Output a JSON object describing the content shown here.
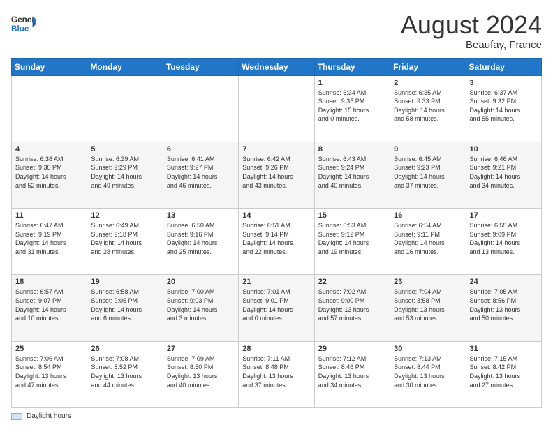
{
  "header": {
    "logo_general": "General",
    "logo_blue": "Blue",
    "month_title": "August 2024",
    "location": "Beaufay, France"
  },
  "legend": {
    "label": "Daylight hours"
  },
  "days_of_week": [
    "Sunday",
    "Monday",
    "Tuesday",
    "Wednesday",
    "Thursday",
    "Friday",
    "Saturday"
  ],
  "weeks": [
    [
      {
        "day": "",
        "info": ""
      },
      {
        "day": "",
        "info": ""
      },
      {
        "day": "",
        "info": ""
      },
      {
        "day": "",
        "info": ""
      },
      {
        "day": "1",
        "info": "Sunrise: 6:34 AM\nSunset: 9:35 PM\nDaylight: 15 hours\nand 0 minutes."
      },
      {
        "day": "2",
        "info": "Sunrise: 6:35 AM\nSunset: 9:33 PM\nDaylight: 14 hours\nand 58 minutes."
      },
      {
        "day": "3",
        "info": "Sunrise: 6:37 AM\nSunset: 9:32 PM\nDaylight: 14 hours\nand 55 minutes."
      }
    ],
    [
      {
        "day": "4",
        "info": "Sunrise: 6:38 AM\nSunset: 9:30 PM\nDaylight: 14 hours\nand 52 minutes."
      },
      {
        "day": "5",
        "info": "Sunrise: 6:39 AM\nSunset: 9:29 PM\nDaylight: 14 hours\nand 49 minutes."
      },
      {
        "day": "6",
        "info": "Sunrise: 6:41 AM\nSunset: 9:27 PM\nDaylight: 14 hours\nand 46 minutes."
      },
      {
        "day": "7",
        "info": "Sunrise: 6:42 AM\nSunset: 9:26 PM\nDaylight: 14 hours\nand 43 minutes."
      },
      {
        "day": "8",
        "info": "Sunrise: 6:43 AM\nSunset: 9:24 PM\nDaylight: 14 hours\nand 40 minutes."
      },
      {
        "day": "9",
        "info": "Sunrise: 6:45 AM\nSunset: 9:23 PM\nDaylight: 14 hours\nand 37 minutes."
      },
      {
        "day": "10",
        "info": "Sunrise: 6:46 AM\nSunset: 9:21 PM\nDaylight: 14 hours\nand 34 minutes."
      }
    ],
    [
      {
        "day": "11",
        "info": "Sunrise: 6:47 AM\nSunset: 9:19 PM\nDaylight: 14 hours\nand 31 minutes."
      },
      {
        "day": "12",
        "info": "Sunrise: 6:49 AM\nSunset: 9:18 PM\nDaylight: 14 hours\nand 28 minutes."
      },
      {
        "day": "13",
        "info": "Sunrise: 6:50 AM\nSunset: 9:16 PM\nDaylight: 14 hours\nand 25 minutes."
      },
      {
        "day": "14",
        "info": "Sunrise: 6:51 AM\nSunset: 9:14 PM\nDaylight: 14 hours\nand 22 minutes."
      },
      {
        "day": "15",
        "info": "Sunrise: 6:53 AM\nSunset: 9:12 PM\nDaylight: 14 hours\nand 19 minutes."
      },
      {
        "day": "16",
        "info": "Sunrise: 6:54 AM\nSunset: 9:11 PM\nDaylight: 14 hours\nand 16 minutes."
      },
      {
        "day": "17",
        "info": "Sunrise: 6:55 AM\nSunset: 9:09 PM\nDaylight: 14 hours\nand 13 minutes."
      }
    ],
    [
      {
        "day": "18",
        "info": "Sunrise: 6:57 AM\nSunset: 9:07 PM\nDaylight: 14 hours\nand 10 minutes."
      },
      {
        "day": "19",
        "info": "Sunrise: 6:58 AM\nSunset: 9:05 PM\nDaylight: 14 hours\nand 6 minutes."
      },
      {
        "day": "20",
        "info": "Sunrise: 7:00 AM\nSunset: 9:03 PM\nDaylight: 14 hours\nand 3 minutes."
      },
      {
        "day": "21",
        "info": "Sunrise: 7:01 AM\nSunset: 9:01 PM\nDaylight: 14 hours\nand 0 minutes."
      },
      {
        "day": "22",
        "info": "Sunrise: 7:02 AM\nSunset: 9:00 PM\nDaylight: 13 hours\nand 57 minutes."
      },
      {
        "day": "23",
        "info": "Sunrise: 7:04 AM\nSunset: 8:58 PM\nDaylight: 13 hours\nand 53 minutes."
      },
      {
        "day": "24",
        "info": "Sunrise: 7:05 AM\nSunset: 8:56 PM\nDaylight: 13 hours\nand 50 minutes."
      }
    ],
    [
      {
        "day": "25",
        "info": "Sunrise: 7:06 AM\nSunset: 8:54 PM\nDaylight: 13 hours\nand 47 minutes."
      },
      {
        "day": "26",
        "info": "Sunrise: 7:08 AM\nSunset: 8:52 PM\nDaylight: 13 hours\nand 44 minutes."
      },
      {
        "day": "27",
        "info": "Sunrise: 7:09 AM\nSunset: 8:50 PM\nDaylight: 13 hours\nand 40 minutes."
      },
      {
        "day": "28",
        "info": "Sunrise: 7:11 AM\nSunset: 8:48 PM\nDaylight: 13 hours\nand 37 minutes."
      },
      {
        "day": "29",
        "info": "Sunrise: 7:12 AM\nSunset: 8:46 PM\nDaylight: 13 hours\nand 34 minutes."
      },
      {
        "day": "30",
        "info": "Sunrise: 7:13 AM\nSunset: 8:44 PM\nDaylight: 13 hours\nand 30 minutes."
      },
      {
        "day": "31",
        "info": "Sunrise: 7:15 AM\nSunset: 8:42 PM\nDaylight: 13 hours\nand 27 minutes."
      }
    ]
  ]
}
